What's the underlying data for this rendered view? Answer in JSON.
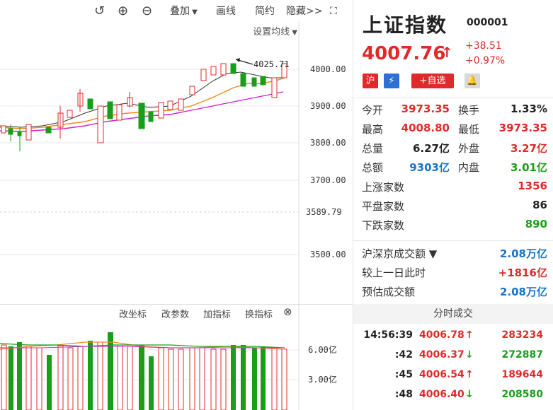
{
  "toolbar": {
    "undo_icon": "undo-icon",
    "zoom_in_icon": "zoom-in-icon",
    "zoom_out_icon": "zoom-out-icon",
    "overlay_label": "叠加",
    "draw_label": "画线",
    "simple_label": "简约",
    "hide_label": "隐藏>>",
    "fullscreen_icon": "fullscreen-icon"
  },
  "chart": {
    "ma_settings_label": "设置均线",
    "peak_label": "4025.71",
    "y_labels": [
      "4000.00",
      "3900.00",
      "3800.00",
      "3700.00",
      "3589.79",
      "3500.00"
    ],
    "vol_y_labels": [
      "6.00亿",
      "3.00亿"
    ]
  },
  "volume_toolbar": {
    "change_axis": "改坐标",
    "change_params": "改参数",
    "add_indicator": "加指标",
    "swap_indicator": "换指标"
  },
  "quote": {
    "name": "上证指数",
    "code": "000001",
    "price": "4007.76",
    "change": "+38.51",
    "change_pct": "+0.97%",
    "badge_market": "沪",
    "badge_add": "+自选"
  },
  "stats": [
    {
      "label": "今开",
      "value": "3973.35",
      "label2": "换手",
      "value2": "1.33%"
    },
    {
      "label": "最高",
      "value": "4008.80",
      "label2": "最低",
      "value2": "3973.35"
    },
    {
      "label": "总量",
      "value": "6.27亿",
      "label2": "外盘",
      "value2": "3.27亿"
    },
    {
      "label": "总额",
      "value": "9303亿",
      "label2": "内盘",
      "value2": "3.01亿"
    }
  ],
  "breadth": [
    {
      "label": "上涨家数",
      "value": "1356"
    },
    {
      "label": "平盘家数",
      "value": "86"
    },
    {
      "label": "下跌家数",
      "value": "890"
    }
  ],
  "turnover": [
    {
      "label": "沪深京成交额 ▼",
      "value": "2.08万亿"
    },
    {
      "label": "较上一日此时",
      "value": "+1816亿"
    },
    {
      "label": "预估成交额",
      "value": "2.08万亿"
    }
  ],
  "ticks_title": "分时成交",
  "ticks": [
    {
      "time": "14:56:39",
      "price": "4006.78",
      "arrow": "↑",
      "qty": "283234"
    },
    {
      "time": ":42",
      "price": "4006.37",
      "arrow": "↓",
      "qty": "272887"
    },
    {
      "time": ":45",
      "price": "4006.54",
      "arrow": "↑",
      "qty": "189644"
    },
    {
      "time": ":48",
      "price": "4006.40",
      "arrow": "↓",
      "qty": "208580"
    }
  ]
}
